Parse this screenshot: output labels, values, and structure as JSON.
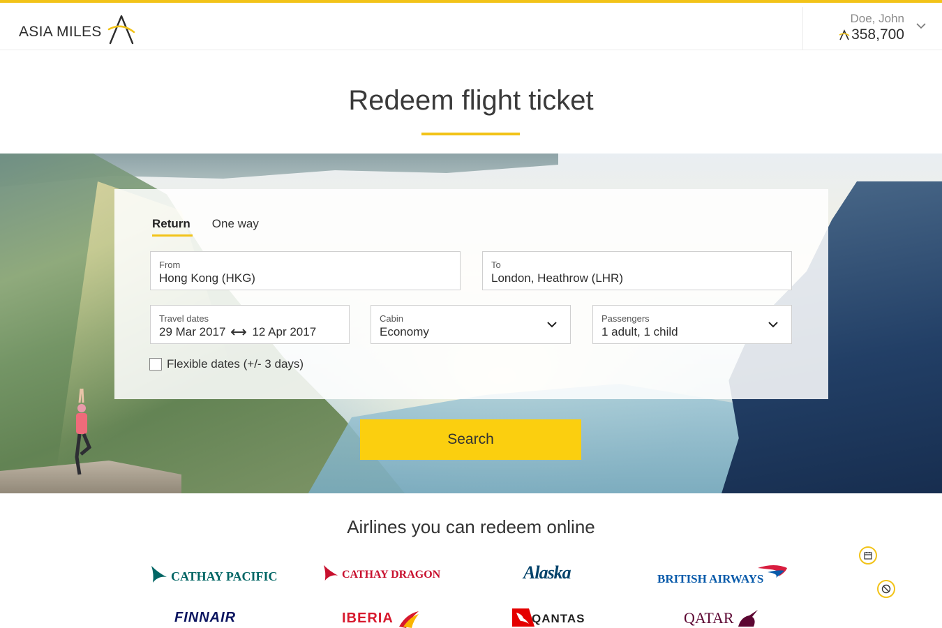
{
  "header": {
    "logo_text": "ASIA MILES",
    "account_name": "Doe, John",
    "account_miles": "358,700",
    "accent_color": "#f2c318"
  },
  "page": {
    "title": "Redeem flight ticket"
  },
  "search": {
    "tabs": [
      "Return",
      "One way"
    ],
    "active_tab": "Return",
    "from_label": "From",
    "from_value": "Hong Kong (HKG)",
    "to_label": "To",
    "to_value": "London, Heathrow (LHR)",
    "dates_label": "Travel dates",
    "depart_date": "29 Mar 2017",
    "return_date": "12 Apr 2017",
    "cabin_label": "Cabin",
    "cabin_value": "Economy",
    "passengers_label": "Passengers",
    "passengers_value": "1 adult, 1 child",
    "flexible_label": "Flexible dates (+/- 3 days)",
    "flexible_checked": false,
    "button_label": "Search",
    "button_color": "#fbcf0f"
  },
  "airlines": {
    "title": "Airlines you can redeem online",
    "items": [
      {
        "name": "CATHAY PACIFIC",
        "icon": "cathay-pacific-brushwing-icon",
        "color": "#006564"
      },
      {
        "name": "CATHAY DRAGON",
        "icon": "cathay-dragon-brushwing-icon",
        "color": "#c8102e"
      },
      {
        "name": "Alaska",
        "icon": "alaska-script-logo",
        "color": "#01426a"
      },
      {
        "name": "BRITISH AIRWAYS",
        "icon": "british-airways-speedmarque-icon",
        "color": "#075aaa"
      },
      {
        "name": "FINNAIR",
        "icon": "finnair-logo",
        "color": "#0b1560"
      },
      {
        "name": "IBERIA",
        "icon": "iberia-wing-icon",
        "color": "#d7192d"
      },
      {
        "name": "QANTAS",
        "icon": "qantas-kangaroo-icon",
        "color": "#e40000"
      },
      {
        "name": "QATAR",
        "icon": "qatar-oryx-icon",
        "color": "#5c0632"
      }
    ]
  }
}
